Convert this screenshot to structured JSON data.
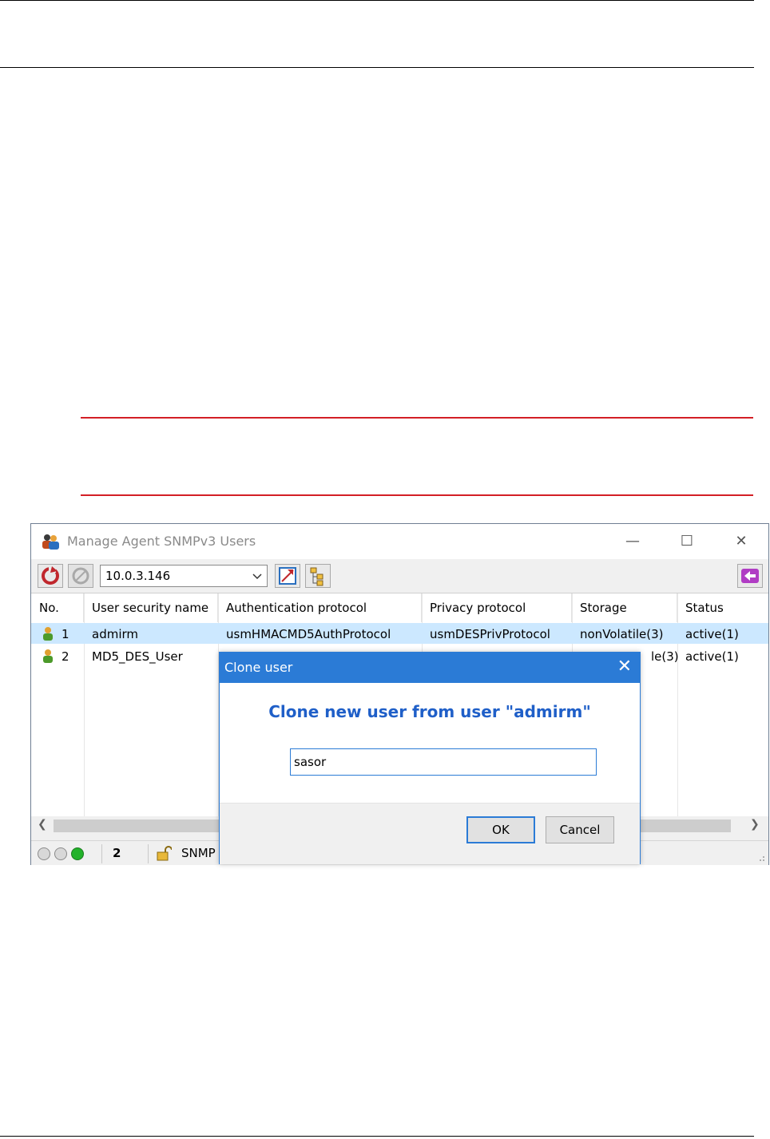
{
  "window": {
    "title": "Manage Agent SNMPv3 Users",
    "minimize": "—",
    "maximize": "☐",
    "close": "✕"
  },
  "toolbar": {
    "address_value": "10.0.3.146"
  },
  "table": {
    "columns": [
      "No.",
      "User security name",
      "Authentication protocol",
      "Privacy protocol",
      "Storage",
      "Status"
    ],
    "rows": [
      {
        "no": "1",
        "name": "admirm",
        "auth": "usmHMACMD5AuthProtocol",
        "priv": "usmDESPrivProtocol",
        "storage": "nonVolatile(3)",
        "status": "active(1)"
      },
      {
        "no": "2",
        "name": "MD5_DES_User",
        "storage_visible": "le(3)",
        "status": "active(1)"
      }
    ]
  },
  "statusbar": {
    "count": "2",
    "mode": "SNMP"
  },
  "dialog": {
    "title": "Clone user",
    "heading": "Clone new user from user \"admirm\"",
    "input_value": "sasor",
    "ok_label": "OK",
    "cancel_label": "Cancel"
  },
  "colors": {
    "accent": "#2b7bd6",
    "heading": "#1f5fc8",
    "selection": "#cce8ff",
    "rule_red": "#d31f26"
  }
}
